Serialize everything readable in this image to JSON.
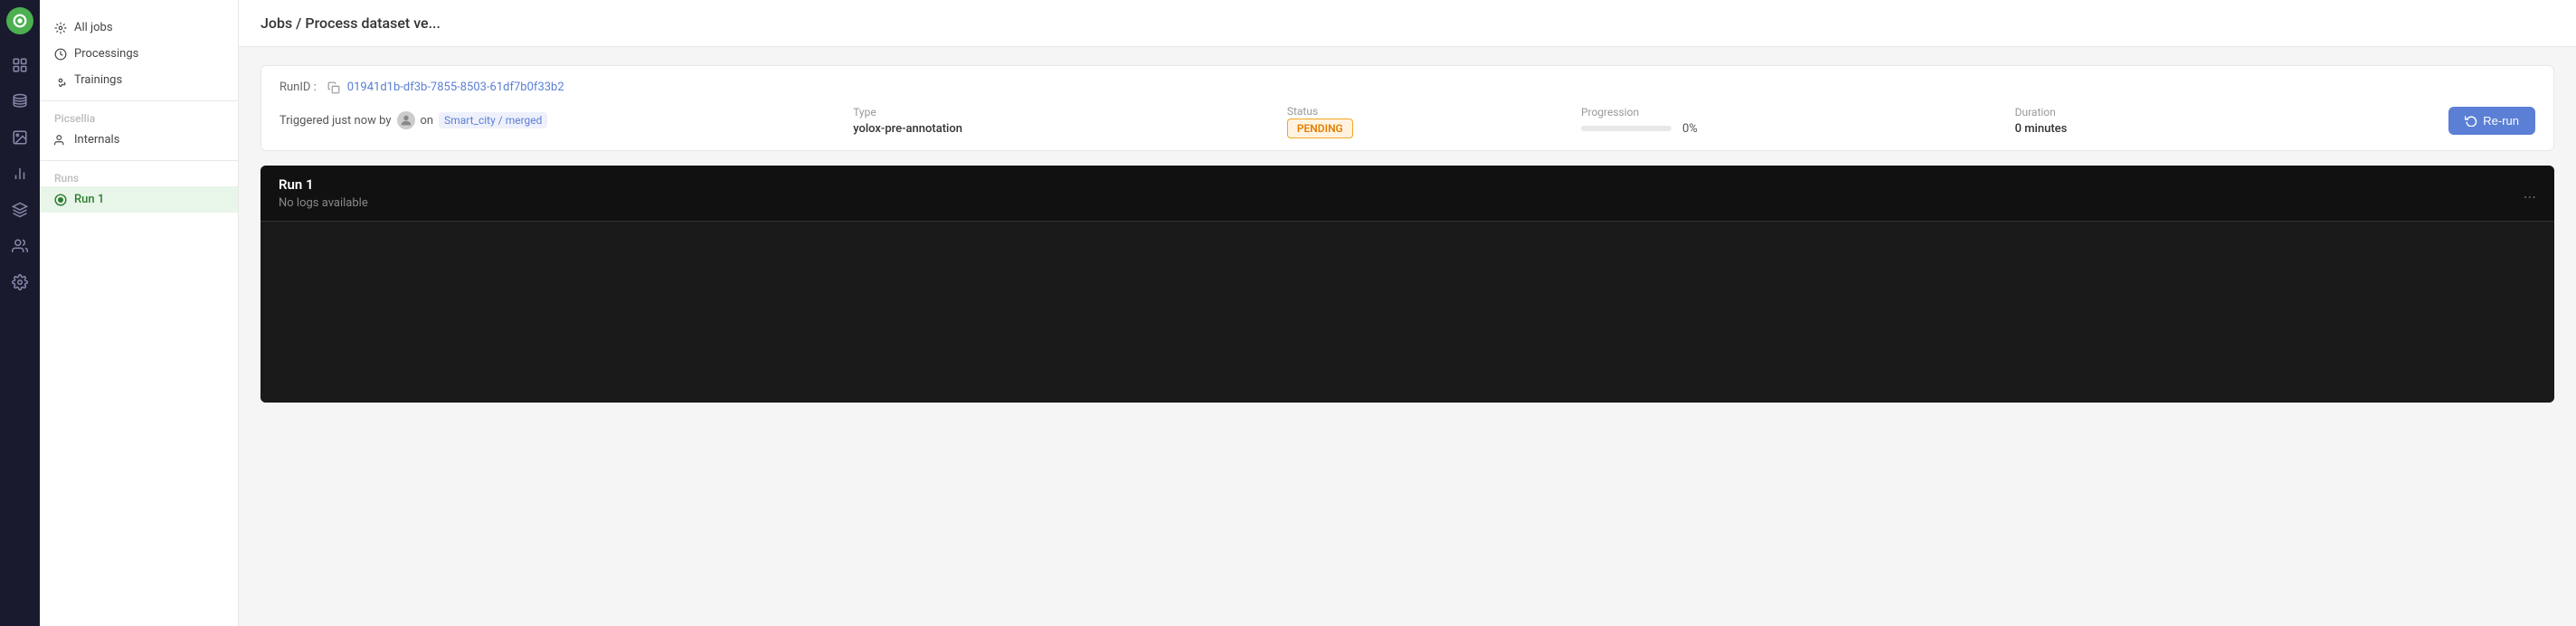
{
  "iconBar": {
    "logo": "O"
  },
  "sidebar": {
    "allJobs": "All jobs",
    "processings": "Processings",
    "trainings": "Trainings",
    "sectionLabel": "Picsellia",
    "internals": "Internals",
    "runsLabel": "Runs",
    "run1": "Run 1"
  },
  "header": {
    "breadcrumb": "Jobs / Process dataset ve..."
  },
  "jobCard": {
    "runIdLabel": "RunID :",
    "runIdValue": "01941d1b-df3b-7855-8503-61df7b0f33b2",
    "triggeredText": "Triggered just now by",
    "onText": "on",
    "branchLink": "Smart_city / merged",
    "typeLabel": "Type",
    "typeValue": "yolox-pre-annotation",
    "statusLabel": "Status",
    "statusValue": "PENDING",
    "progressionLabel": "Progression",
    "progressionPct": "0%",
    "progressionBarWidth": "0",
    "durationLabel": "Duration",
    "durationValue": "0 minutes",
    "rerunLabel": "Re-run"
  },
  "runLog": {
    "title": "Run 1",
    "noLogsText": "No logs available",
    "dotsIcon": "..."
  }
}
